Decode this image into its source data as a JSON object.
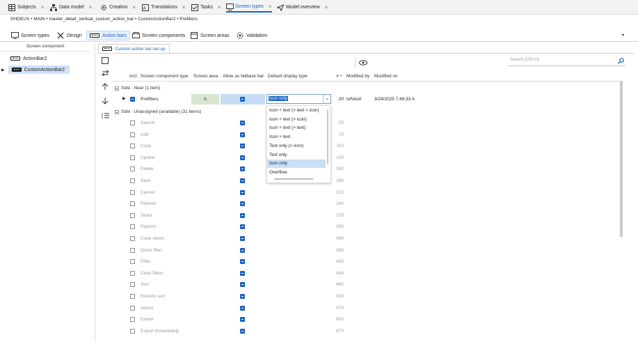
{
  "top_tabs": [
    {
      "label": "Subjects",
      "icon": "table-icon",
      "active": false
    },
    {
      "label": "Data model",
      "icon": "hierarchy-icon",
      "active": false
    },
    {
      "label": "Creation",
      "icon": "gear-icon",
      "active": false
    },
    {
      "label": "Translations",
      "icon": "translate-icon",
      "active": false
    },
    {
      "label": "Tasks",
      "icon": "checkbox-icon",
      "active": false
    },
    {
      "label": "Screen types",
      "icon": "monitor-icon",
      "active": true
    },
    {
      "label": "Model overview",
      "icon": "send-icon",
      "active": false
    }
  ],
  "breadcrumb": "SHOEUX • MAIN • master_detail_vertical_custom_action_bar • CustomActionBar2 • Prefilters",
  "sub_tabs": [
    {
      "label": "Screen types",
      "icon": "monitor-icon"
    },
    {
      "label": "Design",
      "icon": "tools-icon"
    },
    {
      "label": "Action bars",
      "icon": "actionbar-icon",
      "active": true
    },
    {
      "label": "Screen components",
      "icon": "component-icon"
    },
    {
      "label": "Screen areas",
      "icon": "areas-icon"
    },
    {
      "label": "Validation",
      "icon": "validation-icon"
    }
  ],
  "left_panel": {
    "header": "Screen component",
    "items": [
      {
        "label": "ActionBar2"
      },
      {
        "label": "CustomActionBar2",
        "selected": true
      }
    ]
  },
  "content_tab": "Custom action bar set-up",
  "search": {
    "placeholder": "Search (Ctrl+O)"
  },
  "columns": {
    "incl": "Incl.",
    "component_type": "Screen component type",
    "area": "Screen area",
    "fallback": "Allow as fallback bar",
    "display_type": "Default display type",
    "order": "# ÷",
    "modified_by": "Modified by",
    "modified_on": "Modified on"
  },
  "group_near": "Side : Near (1 item)",
  "active_row": {
    "name": "Prefilters",
    "area": "A",
    "display_type": "Icon only",
    "order": "20",
    "modified_by": "tsf\\rkort",
    "modified_on": "3/24/2025 7:49:33 A"
  },
  "group_unassigned": "Side : Unassigned (available) (31 items)",
  "dropdown_options": [
    "Icon + text (> text > icon)",
    "Icon + text (> icon)",
    "Icon + text (> text)",
    "Icon + text",
    "Text only (> icon)",
    "Text only",
    "Icon only",
    "Overflow"
  ],
  "dropdown_selected_index": 6,
  "rows": [
    {
      "name": "Search",
      "order": "20"
    },
    {
      "name": "Add",
      "order": "70"
    },
    {
      "name": "Copy",
      "order": "110"
    },
    {
      "name": "Update",
      "order": "130"
    },
    {
      "name": "Delete",
      "order": "150"
    },
    {
      "name": "Save",
      "order": "180"
    },
    {
      "name": "Cancel",
      "order": "210"
    },
    {
      "name": "Refresh",
      "order": "240"
    },
    {
      "name": "Tasks",
      "order": "270"
    },
    {
      "name": "Reports",
      "order": "300"
    },
    {
      "name": "Cube views",
      "order": "340"
    },
    {
      "name": "Quick filter",
      "order": "390"
    },
    {
      "name": "Filter",
      "order": "420"
    },
    {
      "name": "Clear filters",
      "order": "440"
    },
    {
      "name": "Sort",
      "order": "480"
    },
    {
      "name": "Restore sort",
      "order": "530"
    },
    {
      "name": "Import",
      "order": "570"
    },
    {
      "name": "Export",
      "order": "620"
    },
    {
      "name": "Export immediately",
      "order": "670"
    }
  ],
  "colors": {
    "accent": "#1a62c0",
    "selection": "#c5dcf4",
    "area_cell": "#d7e6cf"
  }
}
